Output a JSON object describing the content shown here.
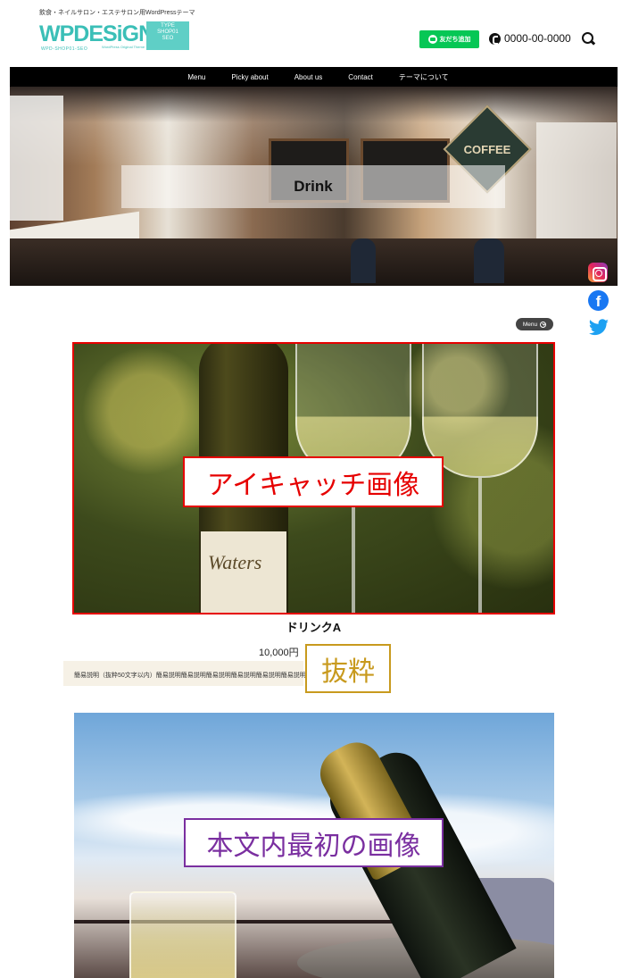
{
  "site": {
    "tagline": "飲食・ネイルサロン・エステサロン用WordPressテーマ",
    "logo": {
      "word": "WPDESiGN",
      "sub": "WPD-SHOP01-SEO",
      "caption": "WordPress Original Theme",
      "tag_lines": [
        "TYPE",
        "SHOP01",
        "SEO"
      ]
    }
  },
  "header": {
    "line_button_label": "友だち追加",
    "phone": "0000-00-0000"
  },
  "nav": {
    "items": [
      "Menu",
      "Picky about",
      "About us",
      "Contact",
      "テーマについて"
    ]
  },
  "hero": {
    "title": "Drink",
    "sign_text": "COFFEE"
  },
  "social": {
    "facebook_glyph": "f"
  },
  "menu_pill": {
    "label": "Menu"
  },
  "post": {
    "eyecatch_label_text": "Waters",
    "name": "ドリンクA",
    "price": "10,000円",
    "excerpt": "簡易説明（抜粋50文字以内）簡易説明簡易説明簡易説明簡易説明簡易説明簡易説明"
  },
  "annotations": {
    "eyecatch": "アイキャッチ画像",
    "excerpt": "抜粋",
    "first_body_image": "本文内最初の画像"
  },
  "colors": {
    "accent_teal": "#3bbfb7",
    "line_green": "#06c755",
    "annotation_red": "#e60000",
    "annotation_gold": "#c89a1e",
    "annotation_purple": "#7a2fa0"
  },
  "icons": [
    "phone-icon",
    "search-icon",
    "line-icon",
    "instagram-icon",
    "facebook-icon",
    "twitter-icon",
    "chevron-down-icon"
  ]
}
